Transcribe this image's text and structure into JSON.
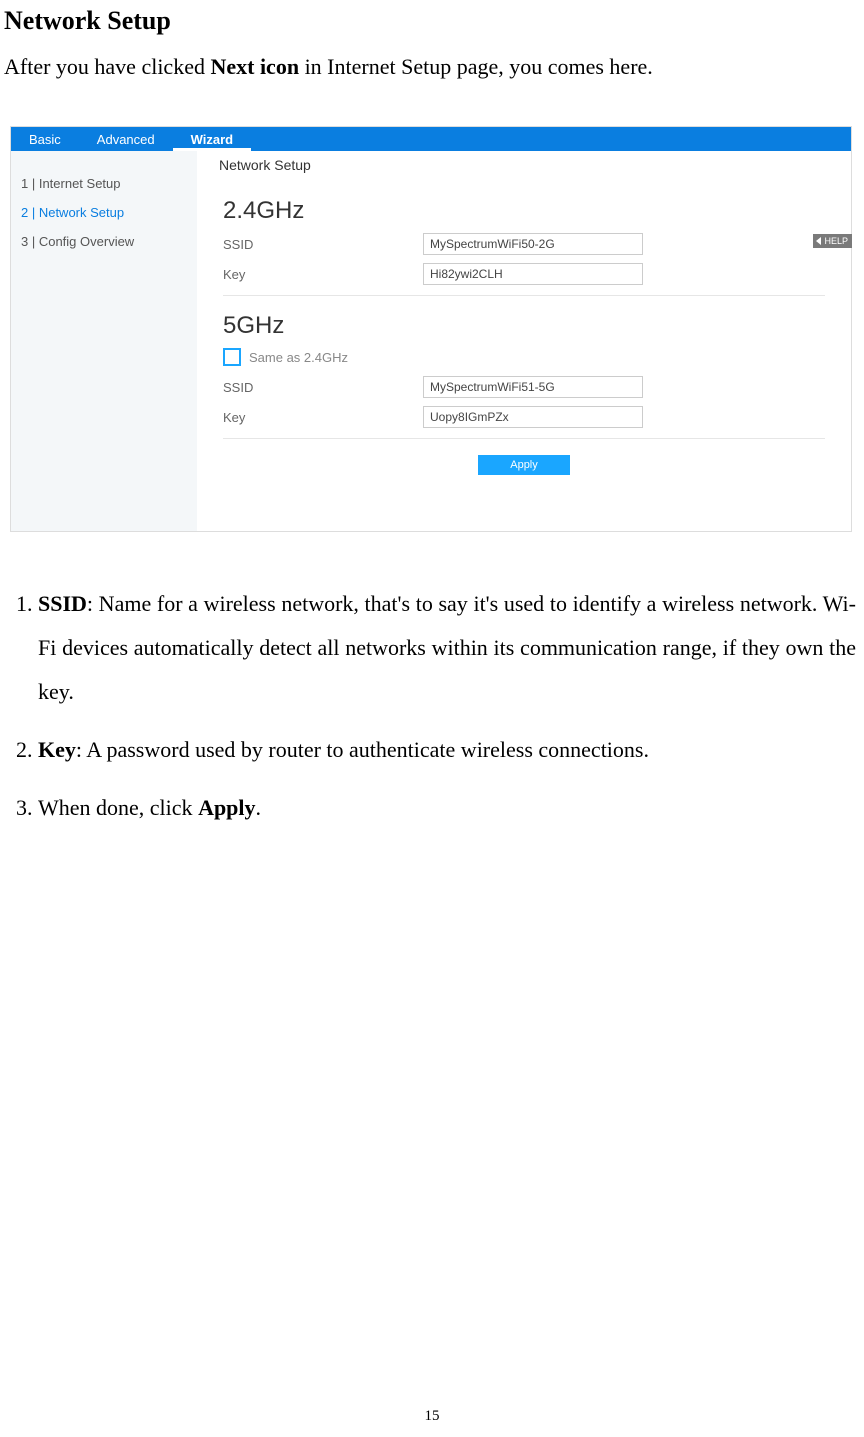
{
  "document": {
    "title": "Network Setup",
    "intro_pre": "After you have clicked ",
    "intro_bold": "Next icon",
    "intro_post": " in Internet Setup page, you comes here.",
    "page_number": "15"
  },
  "screenshot": {
    "tabs": {
      "basic": "Basic",
      "advanced": "Advanced",
      "wizard": "Wizard"
    },
    "sidebar": {
      "item1": "1 | Internet Setup",
      "item2": "2 | Network Setup",
      "item3": "3 | Config Overview"
    },
    "page_title": "Network Setup",
    "help": "HELP",
    "band24": {
      "heading": "2.4GHz",
      "ssid_label": "SSID",
      "ssid_value": "MySpectrumWiFi50-2G",
      "key_label": "Key",
      "key_value": "Hi82ywi2CLH"
    },
    "band5": {
      "heading": "5GHz",
      "same_label": "Same as 2.4GHz",
      "ssid_label": "SSID",
      "ssid_value": "MySpectrumWiFi51-5G",
      "key_label": "Key",
      "key_value": "Uopy8IGmPZx"
    },
    "apply": "Apply"
  },
  "list": {
    "i1_b": "SSID",
    "i1_rest": ": Name for a wireless network, that's to say it's used to identify a wireless network. Wi-Fi devices automatically detect all networks within its communication range, if they own the key.",
    "i2_b": "Key",
    "i2_rest": ": A password used by router to authenticate wireless connections.",
    "i3_pre": "When done, click ",
    "i3_b": "Apply",
    "i3_post": "."
  }
}
